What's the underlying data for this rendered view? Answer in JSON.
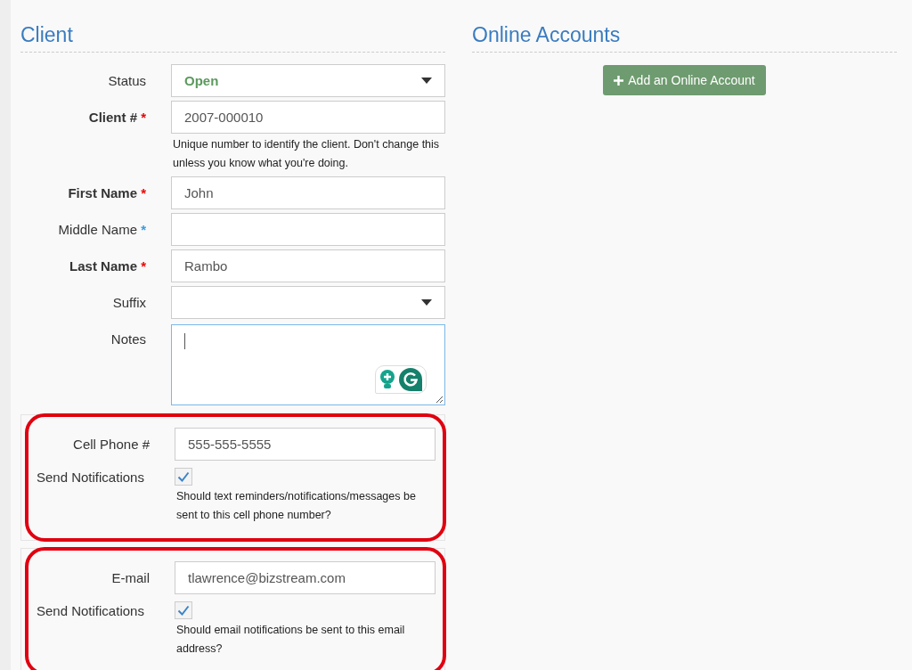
{
  "client": {
    "heading": "Client",
    "fields": [
      {
        "kind": "select",
        "label": "Status",
        "value": "Open",
        "accent": true
      },
      {
        "kind": "text",
        "label": "Client #",
        "marker": "*",
        "required": true,
        "value": "2007-000010",
        "help": "Unique number to identify the client. Don't change this unless you know what you're doing."
      },
      {
        "kind": "text",
        "label": "First Name",
        "marker": "*",
        "required": true,
        "value": "John"
      },
      {
        "kind": "text",
        "label": "Middle Name",
        "marker": "*",
        "required": false
      },
      {
        "kind": "text",
        "label": "Last Name",
        "marker": "*",
        "required": true,
        "value": "Rambo"
      },
      {
        "kind": "select",
        "label": "Suffix"
      },
      {
        "kind": "textarea",
        "label": "Notes",
        "focused": true
      }
    ],
    "groups": [
      {
        "highlighted": true,
        "field_label": "Cell Phone #",
        "value": "555-555-5555",
        "check_label": "Send Notifications",
        "checked": true,
        "help": "Should text reminders/notifications/messages be sent to this cell phone number?"
      },
      {
        "highlighted": true,
        "field_label": "E-mail",
        "value": "tlawrence@bizstream.com",
        "check_label": "Send Notifications",
        "checked": true,
        "help": "Should email notifications be sent to this email address?"
      }
    ]
  },
  "online_accounts": {
    "heading": "Online Accounts",
    "add_button": "Add an Online Account"
  }
}
